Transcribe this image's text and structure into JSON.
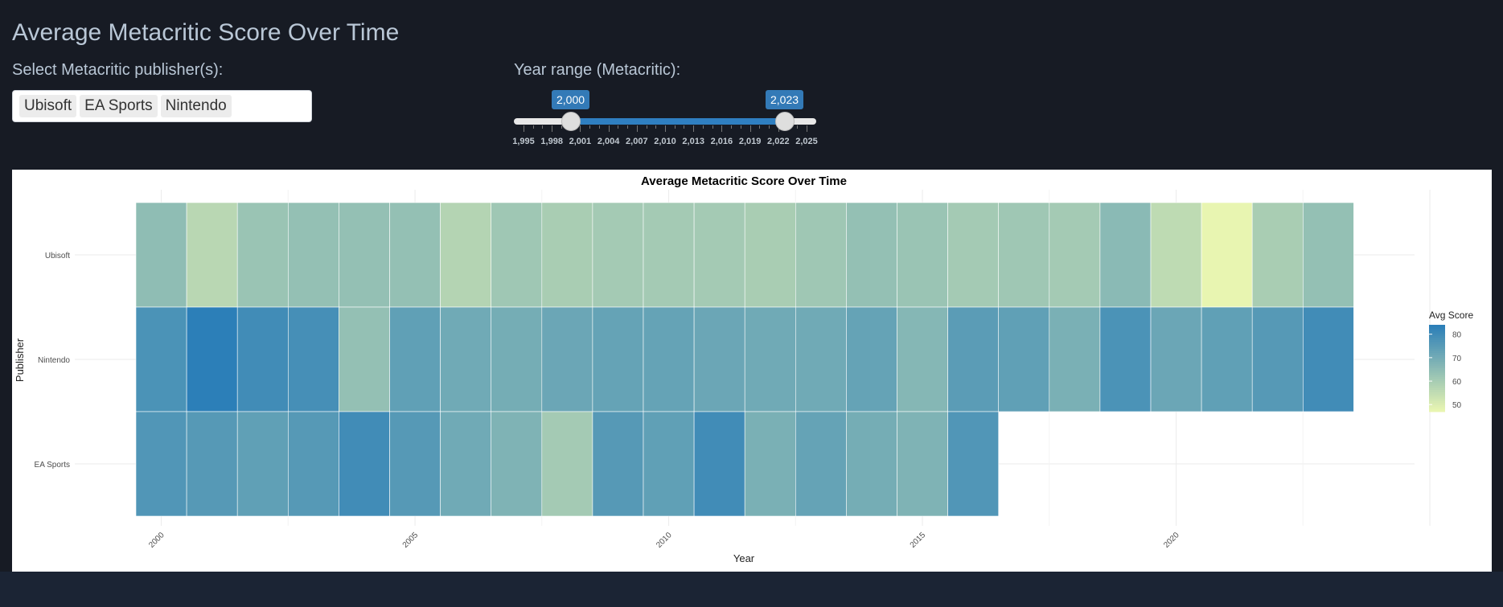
{
  "app": {
    "title": "Average Metacritic Score Over Time"
  },
  "controls": {
    "publisher_label": "Select Metacritic publisher(s):",
    "selected_publishers": [
      "Ubisoft",
      "EA Sports",
      "Nintendo"
    ],
    "year_label": "Year range (Metacritic):",
    "year_range": {
      "min": 1995,
      "max": 2025,
      "from": 2000,
      "to": 2023,
      "from_label": "2,000",
      "to_label": "2,023",
      "tick_labels": [
        "1,995",
        "1,998",
        "2,001",
        "2,004",
        "2,007",
        "2,010",
        "2,013",
        "2,016",
        "2,019",
        "2,022",
        "2,025"
      ]
    }
  },
  "colors": {
    "page_bg": "#171b24",
    "accent": "#337ab7",
    "low": "#edf8b1",
    "high": "#2c7fb8"
  },
  "chart_data": {
    "type": "heatmap",
    "title": "Average Metacritic Score Over Time",
    "xlabel": "Year",
    "ylabel": "Publisher",
    "legend_title": "Avg Score",
    "legend_ticks": [
      50,
      60,
      70,
      80
    ],
    "legend_position": "right",
    "color_range": [
      47,
      84
    ],
    "x": [
      2000,
      2001,
      2002,
      2003,
      2004,
      2005,
      2006,
      2007,
      2008,
      2009,
      2010,
      2011,
      2012,
      2013,
      2014,
      2015,
      2016,
      2017,
      2018,
      2019,
      2020,
      2021,
      2022,
      2023
    ],
    "x_tick_labels": [
      "2000",
      "2005",
      "2010",
      "2015",
      "2020"
    ],
    "y_categories": [
      "Ubisoft",
      "Nintendo",
      "EA Sports"
    ],
    "series": [
      {
        "name": "Ubisoft",
        "values": [
          65,
          57,
          63,
          64,
          64,
          64,
          58,
          62,
          60,
          61,
          61,
          61,
          60,
          62,
          64,
          63,
          61,
          62,
          61,
          66,
          56,
          48,
          60,
          64
        ]
      },
      {
        "name": "Nintendo",
        "values": [
          78,
          84,
          80,
          79,
          64,
          74,
          71,
          70,
          72,
          73,
          73,
          72,
          71,
          71,
          73,
          67,
          75,
          74,
          69,
          78,
          72,
          74,
          76,
          80
        ]
      },
      {
        "name": "EA Sports",
        "values": [
          77,
          76,
          74,
          76,
          80,
          76,
          71,
          68,
          61,
          76,
          74,
          80,
          69,
          73,
          70,
          68,
          77,
          null,
          null,
          null,
          null,
          null,
          null,
          null
        ]
      }
    ],
    "grid": true
  }
}
